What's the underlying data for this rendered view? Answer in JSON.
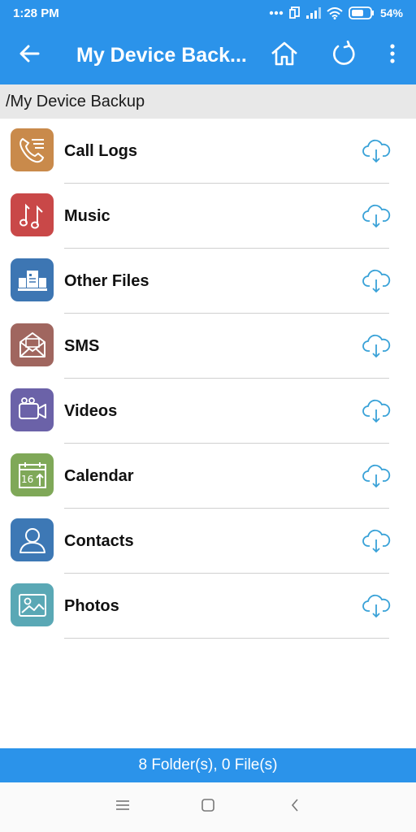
{
  "status_bar": {
    "time": "1:28 PM",
    "battery_percent": "54%"
  },
  "app_bar": {
    "title": "My Device Back..."
  },
  "breadcrumb": {
    "path": "/My Device Backup"
  },
  "items": [
    {
      "label": "Call Logs",
      "icon": "call-logs-icon",
      "color": "#c98a4b"
    },
    {
      "label": "Music",
      "icon": "music-icon",
      "color": "#c94848"
    },
    {
      "label": "Other Files",
      "icon": "other-files-icon",
      "color": "#3d76b3"
    },
    {
      "label": "SMS",
      "icon": "sms-icon",
      "color": "#a0665f"
    },
    {
      "label": "Videos",
      "icon": "videos-icon",
      "color": "#6b62a8"
    },
    {
      "label": "Calendar",
      "icon": "calendar-icon",
      "color": "#7fa858"
    },
    {
      "label": "Contacts",
      "icon": "contacts-icon",
      "color": "#3d78b5"
    },
    {
      "label": "Photos",
      "icon": "photos-icon",
      "color": "#5aa8b5"
    }
  ],
  "calendar_day": "16",
  "footer": {
    "summary": "8 Folder(s), 0 File(s)"
  },
  "colors": {
    "primary": "#2b93ea",
    "cloud_icon": "#3aa2d8"
  }
}
